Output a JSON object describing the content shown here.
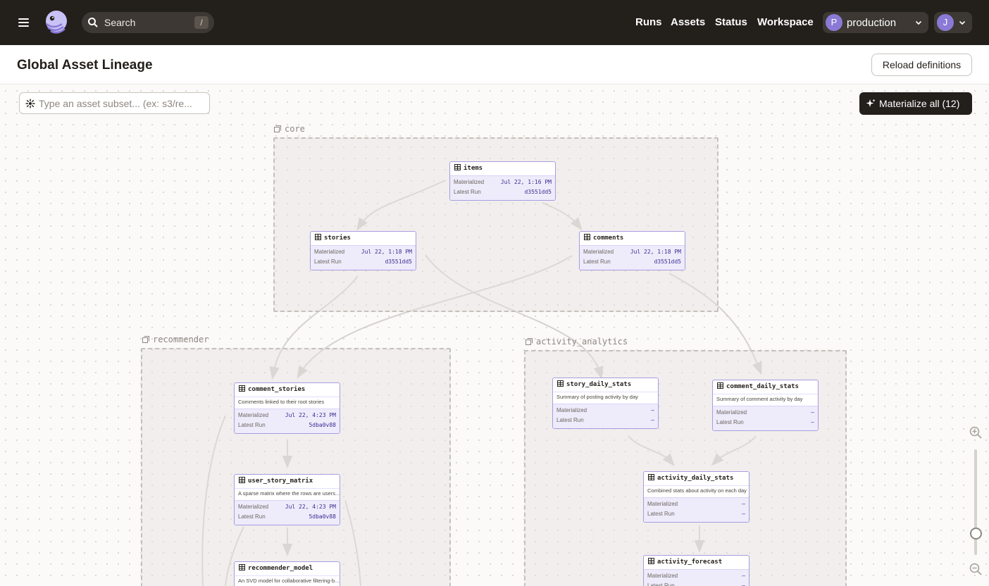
{
  "nav": {
    "search": {
      "placeholder": "Search",
      "shortcut": "/"
    },
    "links": {
      "runs": "Runs",
      "assets": "Assets",
      "status": "Status",
      "workspace": "Workspace"
    },
    "deployment": {
      "initial": "P",
      "name": "production"
    },
    "user": {
      "initial": "J"
    },
    "icons": {
      "menu": "menu-icon",
      "logo": "dagster-logo",
      "search": "search-icon",
      "chevron": "chevron-down-icon"
    }
  },
  "page": {
    "title": "Global Asset Lineage",
    "reload_label": "Reload definitions"
  },
  "toolbar": {
    "subset_placeholder": "Type an asset subset... (ex: s3/re...",
    "materialize_label": "Materialize all (12)"
  },
  "groups": [
    {
      "name": "core"
    },
    {
      "name": "recommender"
    },
    {
      "name": "activity_analytics"
    }
  ],
  "labels": {
    "materialized": "Materialized",
    "latest_run": "Latest Run"
  },
  "assets": [
    {
      "name": "items",
      "materialized": "Jul 22, 1:16 PM",
      "latest_run": "d3551dd5"
    },
    {
      "name": "stories",
      "materialized": "Jul 22, 1:18 PM",
      "latest_run": "d3551dd5"
    },
    {
      "name": "comments",
      "materialized": "Jul 22, 1:18 PM",
      "latest_run": "d3551dd5"
    },
    {
      "name": "comment_stories",
      "description": "Comments linked to their root stories",
      "materialized": "Jul 22, 4:23 PM",
      "latest_run": "5dba0v88"
    },
    {
      "name": "user_story_matrix",
      "description": "A sparse matrix where the rows are users...",
      "materialized": "Jul 22, 4:23 PM",
      "latest_run": "5dba0v88"
    },
    {
      "name": "recommender_model",
      "description": "An SVD model for collaborative filtering-b..."
    },
    {
      "name": "story_daily_stats",
      "description": "Summary of posting activity by day",
      "materialized": "–",
      "latest_run": "–"
    },
    {
      "name": "comment_daily_stats",
      "description": "Summary of comment activity by day",
      "materialized": "–",
      "latest_run": "–"
    },
    {
      "name": "activity_daily_stats",
      "description": "Combined stats about activity on each day",
      "materialized": "–",
      "latest_run": "–"
    },
    {
      "name": "activity_forecast",
      "materialized": "–",
      "latest_run": "–"
    }
  ]
}
